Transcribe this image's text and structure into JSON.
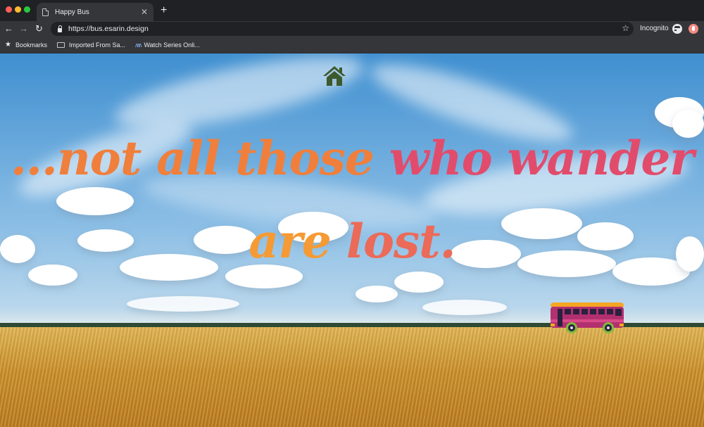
{
  "browser": {
    "tab_title": "Happy Bus",
    "url": "https://bus.esarin.design",
    "mode_label": "Incognito",
    "bookmarks": [
      {
        "label": "Bookmarks",
        "icon": "star-icon"
      },
      {
        "label": "Imported From Sa...",
        "icon": "folder-icon"
      },
      {
        "label": "Watch Series Onli...",
        "icon": "wave-icon"
      }
    ]
  },
  "page": {
    "quote": {
      "line1": {
        "part1": "...not all those",
        "part2": " who wander"
      },
      "line2": {
        "part1": "are",
        "part2": " lost."
      }
    },
    "colors": {
      "sky": "#4a95d2",
      "field": "#d7a545",
      "text_orange": "#f07f3c",
      "text_pink": "#e24c6c",
      "home_icon": "#3d5a2e",
      "bus_body": "#b2306f",
      "bus_roof": "#f5a623"
    }
  }
}
